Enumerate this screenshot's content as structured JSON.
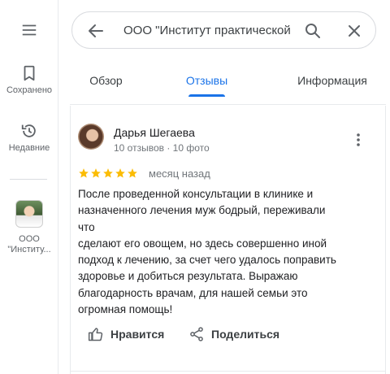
{
  "sidebar": {
    "menu_icon": "hamburger-menu-icon",
    "items": [
      {
        "label": "Сохранено",
        "icon": "bookmark-icon"
      },
      {
        "label": "Недавние",
        "icon": "history-icon"
      }
    ],
    "recent_place": {
      "line1": "ООО",
      "line2": "\"Институ..."
    }
  },
  "search": {
    "query": "ООО \"Институт практической",
    "back_icon": "back-arrow-icon",
    "search_icon": "search-icon",
    "close_icon": "close-icon"
  },
  "tabs": [
    {
      "label": "Обзор",
      "active": false
    },
    {
      "label": "Отзывы",
      "active": true
    },
    {
      "label": "Информация",
      "active": false
    }
  ],
  "review": {
    "author": "Дарья Шегаева",
    "meta": "10 отзывов · 10 фото",
    "rating": 5,
    "date": "месяц назад",
    "lines": [
      "После проведенной консультации в клинике и",
      "назначенного лечения муж бодрый, переживали что",
      "сделают его овощем, но здесь совершенно иной",
      "подход к лечению, за счет чего удалось поправить",
      "здоровье и добиться результата. Выражаю",
      "благодарность врачам, для нашей семьи это",
      "огромная помощь!"
    ],
    "like_label": "Нравится",
    "share_label": "Поделиться"
  },
  "colors": {
    "accent": "#1a73e8",
    "star": "#fbbc04",
    "icon": "#5f6368"
  }
}
